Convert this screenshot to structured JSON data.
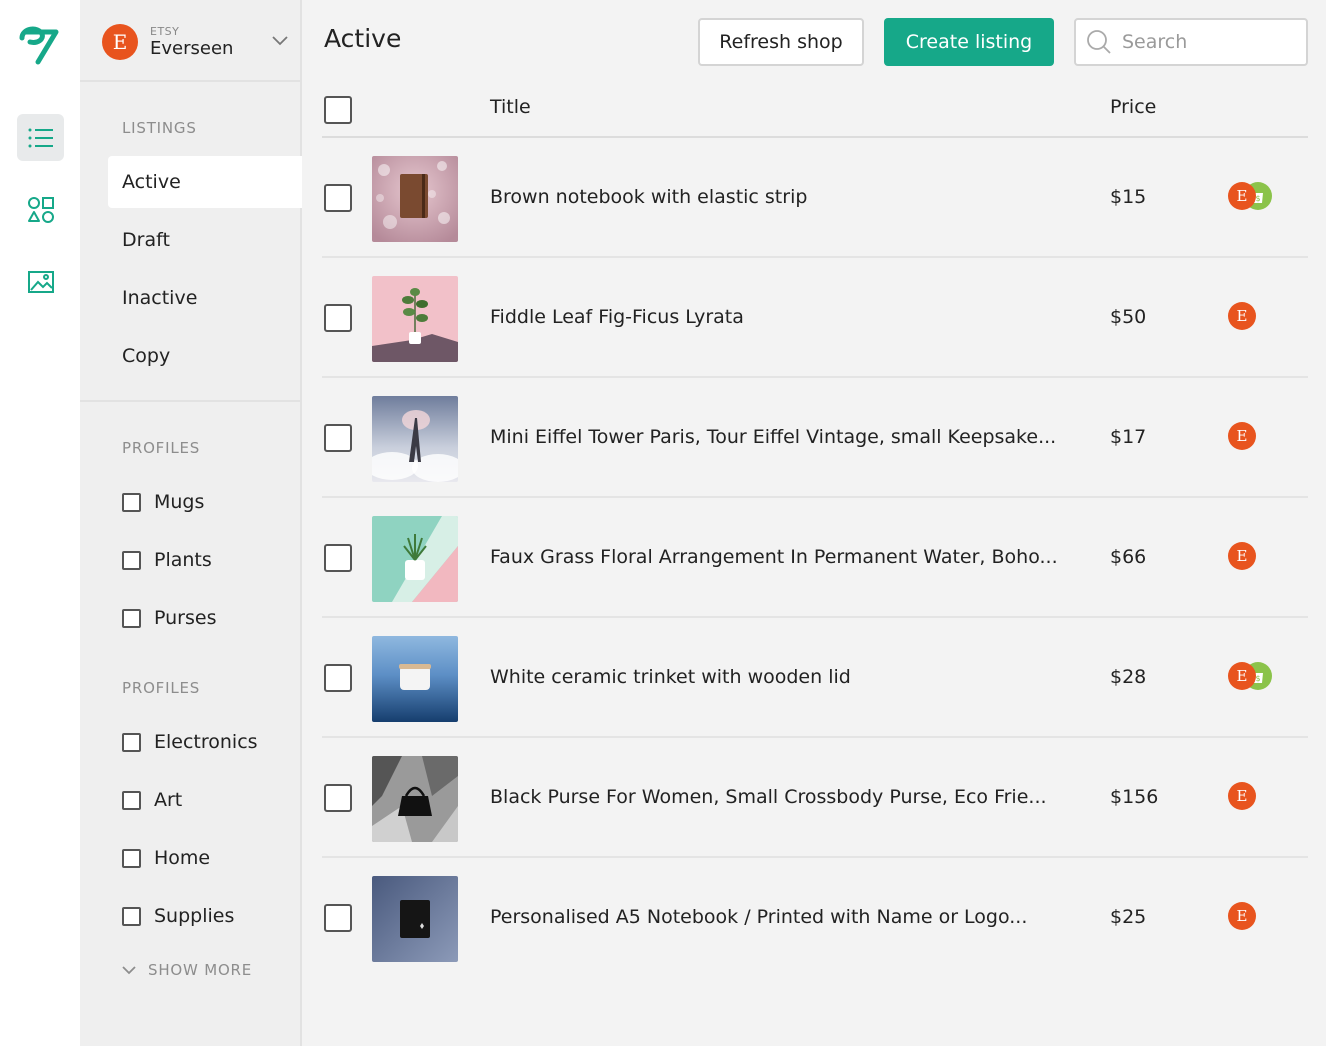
{
  "shop": {
    "platform": "ETSY",
    "name": "Everseen",
    "avatar_letter": "E"
  },
  "sidebar": {
    "listings_title": "LISTINGS",
    "listing_items": [
      "Active",
      "Draft",
      "Inactive",
      "Copy"
    ],
    "selected_listing": "Active",
    "profiles_1_title": "PROFILES",
    "profiles_1": [
      "Mugs",
      "Plants",
      "Purses"
    ],
    "profiles_2_title": "PROFILES",
    "profiles_2": [
      "Electronics",
      "Art",
      "Home",
      "Supplies"
    ],
    "show_more": "SHOW MORE"
  },
  "header": {
    "title": "Active",
    "refresh_label": "Refresh shop",
    "create_label": "Create listing",
    "search_placeholder": "Search"
  },
  "table": {
    "col_title": "Title",
    "col_price": "Price",
    "rows": [
      {
        "title": "Brown notebook with elastic strip",
        "price": "$15",
        "channels": [
          "etsy",
          "shopify"
        ]
      },
      {
        "title": "Fiddle Leaf Fig-Ficus Lyrata",
        "price": "$50",
        "channels": [
          "etsy"
        ]
      },
      {
        "title": "Mini Eiffel Tower Paris, Tour Eiffel Vintage, small Keepsake...",
        "price": "$17",
        "channels": [
          "etsy"
        ]
      },
      {
        "title": "Faux Grass Floral Arrangement In Permanent Water, Boho...",
        "price": "$66",
        "channels": [
          "etsy"
        ]
      },
      {
        "title": "White ceramic trinket with wooden lid",
        "price": "$28",
        "channels": [
          "etsy",
          "shopify"
        ]
      },
      {
        "title": "Black Purse For Women, Small Crossbody Purse, Eco Frie...",
        "price": "$156",
        "channels": [
          "etsy"
        ]
      },
      {
        "title": "Personalised A5 Notebook / Printed with Name or Logo...",
        "price": "$25",
        "channels": [
          "etsy"
        ]
      }
    ]
  },
  "colors": {
    "accent": "#16a889",
    "etsy": "#e8541e",
    "shopify": "#8bc34a"
  }
}
